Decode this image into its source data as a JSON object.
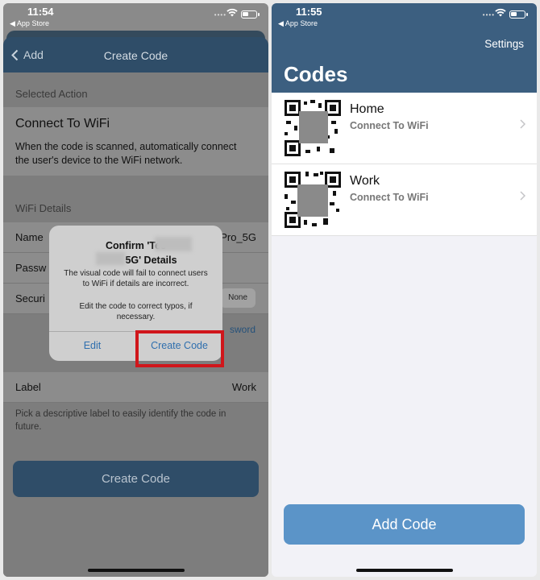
{
  "left_screen": {
    "status": {
      "time": "11:54",
      "back_app": "◀ App Store"
    },
    "nav": {
      "back_label": "Add",
      "title": "Create Code"
    },
    "selected_action": {
      "section_label": "Selected Action",
      "title": "Connect To WiFi",
      "description": "When the code is scanned, automatically connect the user's device to the WiFi network."
    },
    "wifi_details": {
      "section_label": "WiFi Details",
      "name_label": "Name",
      "name_value_partial": "Pro_5G",
      "password_label": "Passw",
      "security_label": "Securi",
      "security_value": "None",
      "show_password_partial": "sword"
    },
    "label_row": {
      "label": "Label",
      "value": "Work"
    },
    "label_note": "Pick a descriptive label to easily identify the code in future.",
    "create_button": "Create Code",
    "alert": {
      "title_part1": "Confirm 'Tec",
      "title_part2": "5G' Details",
      "message": "The visual code will fail to connect users to WiFi if details are incorrect.",
      "message2": "Edit the code to correct typos, if necessary.",
      "edit_button": "Edit",
      "create_button": "Create Code"
    }
  },
  "right_screen": {
    "status": {
      "time": "11:55",
      "back_app": "◀ App Store"
    },
    "settings_label": "Settings",
    "title": "Codes",
    "items": [
      {
        "name": "Home",
        "subtitle": "Connect To WiFi"
      },
      {
        "name": "Work",
        "subtitle": "Connect To WiFi"
      }
    ],
    "add_button": "Add Code"
  },
  "colors": {
    "nav_blue": "#2f4d68",
    "header_blue": "#3c5f80",
    "button_blue": "#5b94c8",
    "highlight_red": "#d0161b",
    "link_blue": "#2f6fae"
  }
}
